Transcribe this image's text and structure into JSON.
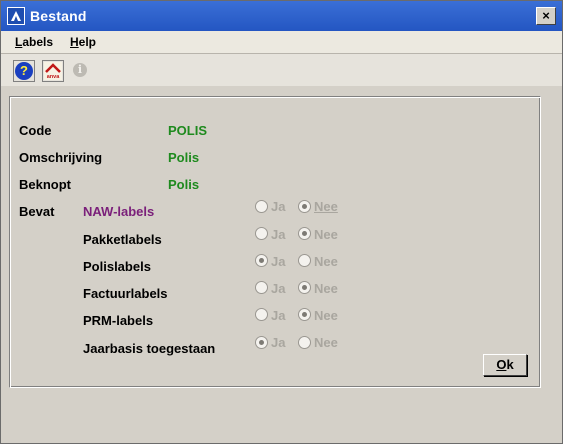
{
  "window": {
    "title": "Bestand",
    "close_label": "×"
  },
  "menu": [
    {
      "mnemonic": "L",
      "rest": "abels"
    },
    {
      "mnemonic": "H",
      "rest": "elp"
    }
  ],
  "toolbar": {
    "help_glyph": "?",
    "anva_label": "anva",
    "info_glyph": "i"
  },
  "form": {
    "code_label": "Code",
    "code_value": "POLIS",
    "omschrijving_label": "Omschrijving",
    "omschrijving_value": "Polis",
    "beknopt_label": "Beknopt",
    "beknopt_value": "Polis",
    "bevat_label": "Bevat",
    "ja_label": "Ja",
    "nee_label": "Nee",
    "items": [
      {
        "label": "NAW-labels",
        "selected": "Nee"
      },
      {
        "label": "Pakketlabels",
        "selected": "Nee"
      },
      {
        "label": "Polislabels",
        "selected": "Ja"
      },
      {
        "label": "Factuurlabels",
        "selected": "Nee"
      },
      {
        "label": "PRM-labels",
        "selected": "Nee"
      },
      {
        "label": "Jaarbasis toegestaan",
        "selected": "Ja"
      }
    ]
  },
  "ok_button": {
    "mnemonic": "O",
    "rest": "k"
  },
  "colors": {
    "title_bar": "#2456c2",
    "value_green": "#1e8a1e",
    "active_purple": "#7a1f7a",
    "disabled_gray": "#a9a69f"
  }
}
